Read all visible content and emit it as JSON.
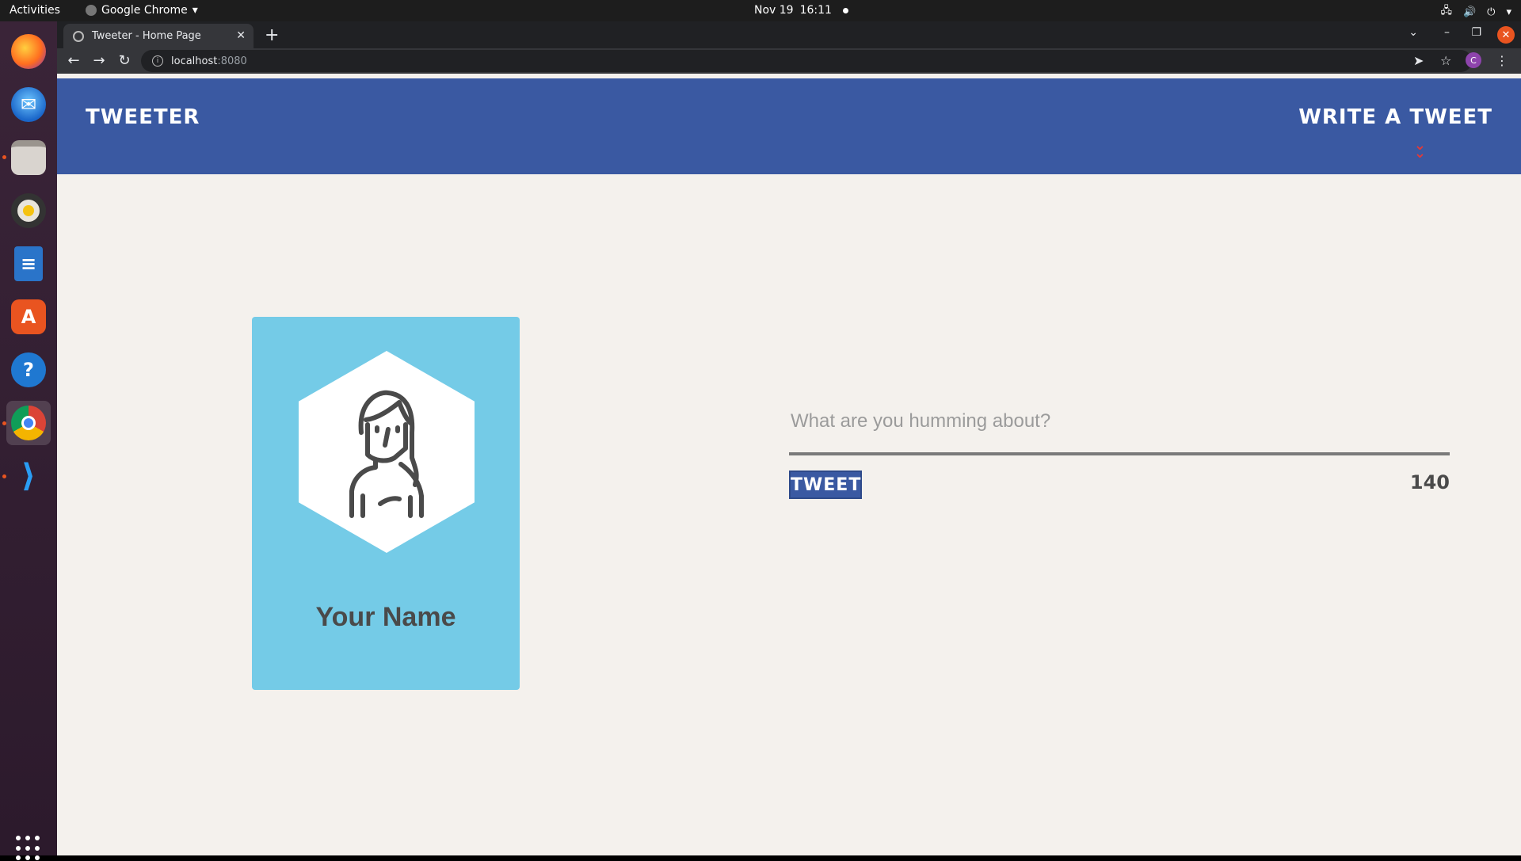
{
  "system": {
    "activities": "Activities",
    "app_name": "Google Chrome",
    "date": "Nov 19",
    "time": "16:11"
  },
  "dock": {
    "items": [
      "firefox-icon",
      "thunderbird-icon",
      "files-icon",
      "rhythmbox-icon",
      "libreoffice-writer-icon",
      "software-icon",
      "help-icon",
      "chrome-icon",
      "vscode-icon"
    ]
  },
  "browser": {
    "tab_title": "Tweeter - Home Page",
    "url_host": "localhost",
    "url_port": ":8080",
    "profile_initial": "C"
  },
  "site": {
    "brand": "Tweeter",
    "write_tweet": "Write a Tweet",
    "accent_color": "#3a59a2"
  },
  "profile": {
    "name": "Your Name",
    "card_color": "#74cbe7"
  },
  "composer": {
    "placeholder": "What are you humming about?",
    "button_label": "Tweet",
    "counter": "140"
  }
}
